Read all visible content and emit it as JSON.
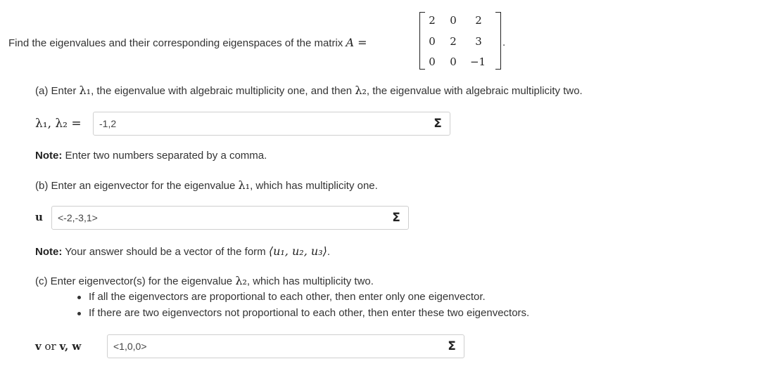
{
  "problem": {
    "prompt": "Find the eigenvalues and their corresponding eigenspaces of the matrix",
    "matrix_symbol": "A =",
    "matrix": [
      [
        "2",
        "0",
        "2"
      ],
      [
        "0",
        "2",
        "3"
      ],
      [
        "0",
        "0",
        "−1"
      ]
    ],
    "end_punct": "."
  },
  "part_a": {
    "text_1": "(a) Enter ",
    "lambda1": "λ₁",
    "text_2": ", the eigenvalue with algebraic multiplicity one, and then ",
    "lambda2": "λ₂",
    "text_3": ", the eigenvalue with algebraic multiplicity two.",
    "answer_label": "λ₁, λ₂ =",
    "answer_value": "-1,2",
    "sigma": "Σ",
    "note_bold": "Note:",
    "note_text": " Enter two numbers separated by a comma."
  },
  "part_b": {
    "text_1": "(b) Enter an eigenvector for the eigenvalue ",
    "lambda1": "λ₁",
    "text_2": ", which has multiplicity one.",
    "answer_label": "u",
    "answer_value": "<-2,-3,1>",
    "sigma": "Σ",
    "note_bold": "Note:",
    "note_text": " Your answer should be a vector of the form ",
    "note_math": "⟨u₁, u₂, u₃⟩",
    "note_end": "."
  },
  "part_c": {
    "text_1": "(c) Enter eigenvector(s) for the eigenvalue ",
    "lambda2": "λ₂",
    "text_2": ", which has multiplicity two.",
    "bullets": [
      "If all the eigenvectors are proportional to each other, then enter only one eigenvector.",
      "If there are two eigenvectors not proportional to each other, then enter these two eigenvectors."
    ],
    "answer_label_v": "v",
    "answer_label_or": "or",
    "answer_label_vw": "v, w",
    "answer_value": "<1,0,0>",
    "sigma": "Σ"
  }
}
